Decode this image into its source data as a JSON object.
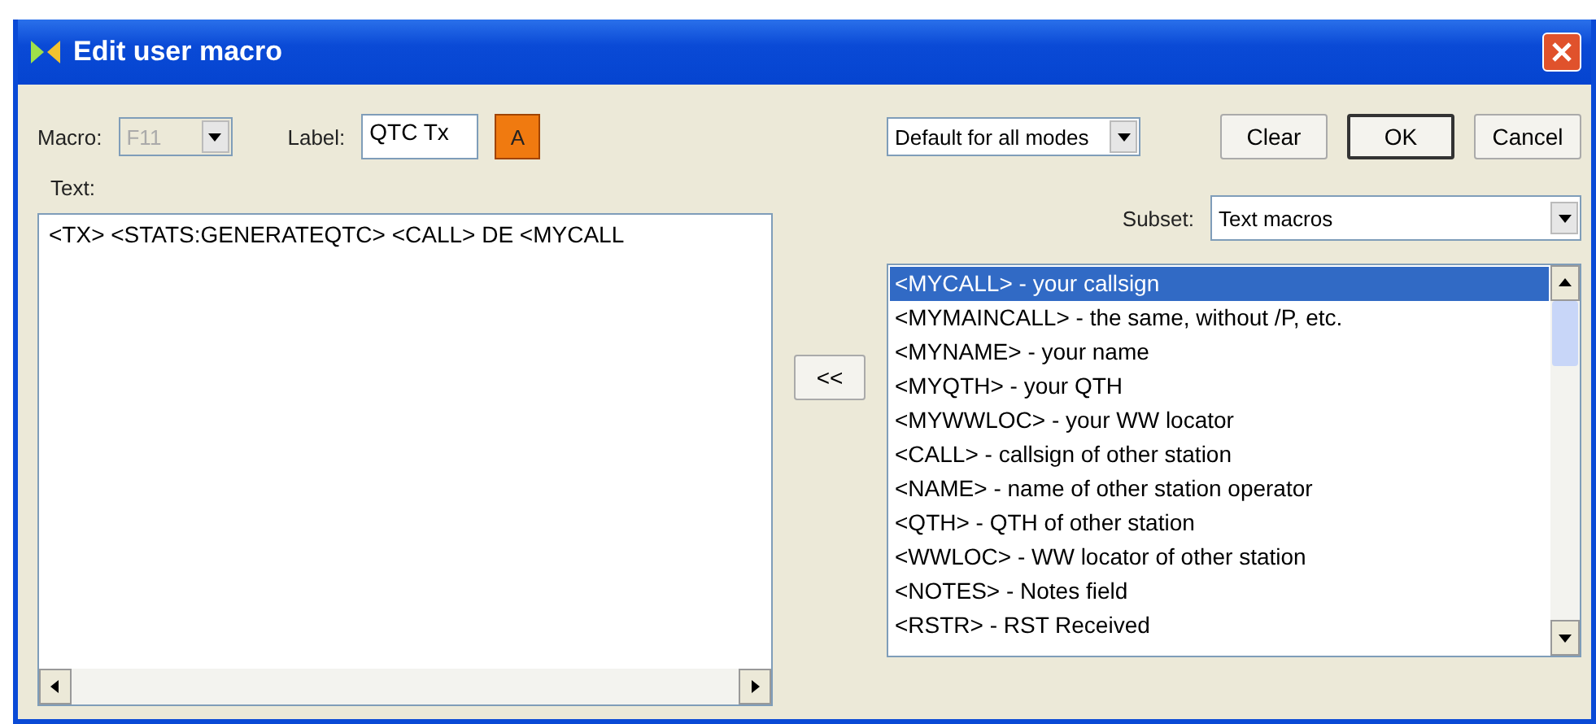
{
  "window": {
    "title": "Edit user macro"
  },
  "macro": {
    "label": "Macro:",
    "value": "F11",
    "disabled": true
  },
  "label_field": {
    "label": "Label:",
    "value": "QTC Tx"
  },
  "color_button": {
    "text": "A"
  },
  "mode_select": {
    "value": "Default for all modes"
  },
  "buttons": [
    {
      "text": "Clear",
      "default": false
    },
    {
      "text": "OK",
      "default": true
    },
    {
      "text": "Cancel",
      "default": false
    }
  ],
  "text_area": {
    "label": "Text:",
    "value": "<TX> <STATS:GENERATEQTC> <CALL> DE <MYCALL"
  },
  "insert_button": {
    "text": "<<"
  },
  "subset": {
    "label": "Subset:",
    "value": "Text macros"
  },
  "macro_list": [
    {
      "text": "<MYCALL> - your callsign",
      "selected": true
    },
    {
      "text": "<MYMAINCALL> - the same, without /P, etc.",
      "selected": false
    },
    {
      "text": "<MYNAME> - your name",
      "selected": false
    },
    {
      "text": "<MYQTH> - your QTH",
      "selected": false
    },
    {
      "text": "<MYWWLOC> - your WW locator",
      "selected": false
    },
    {
      "text": "<CALL> - callsign of other station",
      "selected": false
    },
    {
      "text": "<NAME> - name of other station operator",
      "selected": false
    },
    {
      "text": "<QTH> - QTH of other station",
      "selected": false
    },
    {
      "text": "<WWLOC> - WW locator of other station",
      "selected": false
    },
    {
      "text": "<NOTES> - Notes field",
      "selected": false
    },
    {
      "text": "<RSTR> - RST Received",
      "selected": false
    }
  ]
}
